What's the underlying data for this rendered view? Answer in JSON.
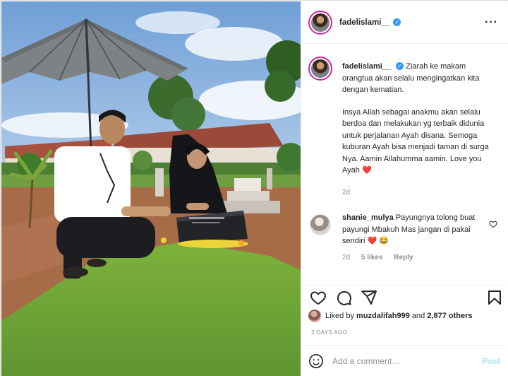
{
  "post": {
    "username": "fadelislami__",
    "verified_mark": "✓",
    "more_label": "···"
  },
  "caption": {
    "username": "fadelislami__",
    "paragraph1": "Ziarah ke makam orangtua akan selalu mengingatkan kita dengan kematian.",
    "paragraph2": "Insya Allah sebagai anakmu akan selalu berdoa dan melakukan yg terbaik didunia untuk perjalanan Ayah disana. Semoga kuburan Ayah bisa menjadi taman di surga Nya. Aamin Allahumma aamin. Love you Ayah",
    "emoji": "❤️",
    "time": "2d"
  },
  "comment": {
    "username": "shanie_mulya",
    "text": "Payungnya tolong buat payungi Mbakuh Mas jangan di pakai sendiri",
    "emoji": "❤️ 😂",
    "time": "2d",
    "likes": "5 likes",
    "reply": "Reply"
  },
  "likes": {
    "prefix": "Liked by",
    "user": "muzdalifah999",
    "and": "and",
    "others": "2,877 others"
  },
  "date": "2 DAYS AGO",
  "input": {
    "placeholder": "Add a comment…"
  },
  "post_button": "Post",
  "colors": {
    "verified": "#3897f0",
    "heart": "#ed4956",
    "post_button": "#b2dffc",
    "muted": "#8e8e8e"
  }
}
